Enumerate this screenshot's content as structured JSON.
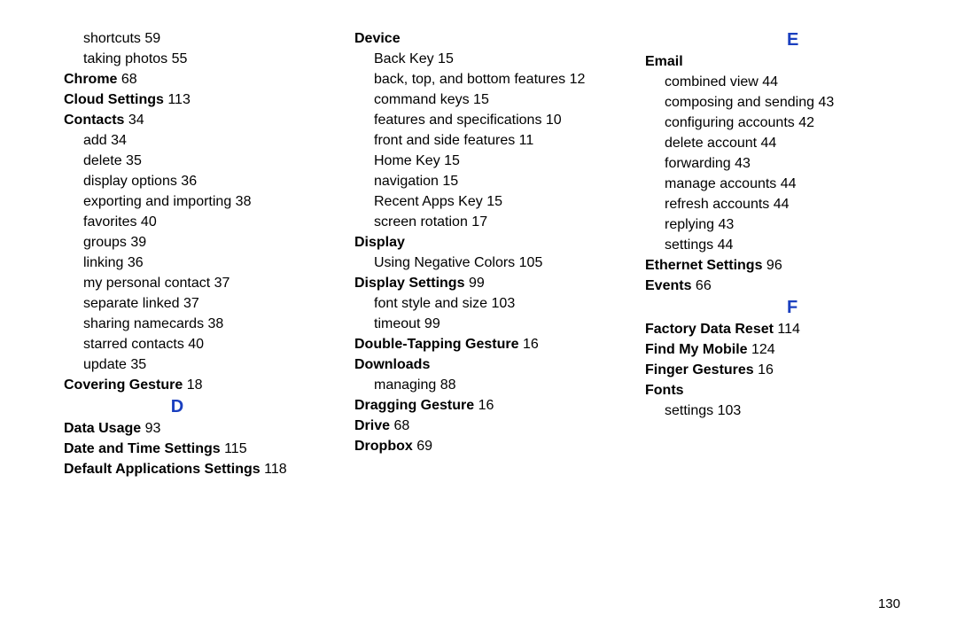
{
  "page_number": "130",
  "columns": [
    {
      "items": [
        {
          "type": "sub",
          "text": "shortcuts",
          "page": "59"
        },
        {
          "type": "sub",
          "text": "taking photos",
          "page": "55"
        },
        {
          "type": "head",
          "text": "Chrome",
          "page": "68"
        },
        {
          "type": "head",
          "text": "Cloud Settings",
          "page": "113"
        },
        {
          "type": "head",
          "text": "Contacts",
          "page": "34"
        },
        {
          "type": "sub",
          "text": "add",
          "page": "34"
        },
        {
          "type": "sub",
          "text": "delete",
          "page": "35"
        },
        {
          "type": "sub",
          "text": "display options",
          "page": "36"
        },
        {
          "type": "sub",
          "text": "exporting and importing",
          "page": "38"
        },
        {
          "type": "sub",
          "text": "favorites",
          "page": "40"
        },
        {
          "type": "sub",
          "text": "groups",
          "page": "39"
        },
        {
          "type": "sub",
          "text": "linking",
          "page": "36"
        },
        {
          "type": "sub",
          "text": "my personal contact",
          "page": "37"
        },
        {
          "type": "sub",
          "text": "separate linked",
          "page": "37"
        },
        {
          "type": "sub",
          "text": "sharing namecards",
          "page": "38"
        },
        {
          "type": "sub",
          "text": "starred contacts",
          "page": "40"
        },
        {
          "type": "sub",
          "text": "update",
          "page": "35"
        },
        {
          "type": "head",
          "text": "Covering Gesture",
          "page": "18"
        },
        {
          "type": "letter",
          "text": "D"
        },
        {
          "type": "head",
          "text": "Data Usage",
          "page": "93"
        },
        {
          "type": "head",
          "text": "Date and Time Settings",
          "page": "115"
        },
        {
          "type": "head",
          "text": "Default Applications Settings",
          "page": "118"
        }
      ]
    },
    {
      "items": [
        {
          "type": "head",
          "text": "Device",
          "page": ""
        },
        {
          "type": "sub",
          "text": "Back Key",
          "page": "15"
        },
        {
          "type": "sub",
          "text": "back, top, and bottom features",
          "page": "12"
        },
        {
          "type": "sub",
          "text": "command keys",
          "page": "15"
        },
        {
          "type": "sub",
          "text": "features and specifications",
          "page": "10"
        },
        {
          "type": "sub",
          "text": "front and side features",
          "page": "11"
        },
        {
          "type": "sub",
          "text": "Home Key",
          "page": "15"
        },
        {
          "type": "sub",
          "text": "navigation",
          "page": "15"
        },
        {
          "type": "sub",
          "text": "Recent Apps Key",
          "page": "15"
        },
        {
          "type": "sub",
          "text": "screen rotation",
          "page": "17"
        },
        {
          "type": "head",
          "text": "Display",
          "page": ""
        },
        {
          "type": "sub",
          "text": "Using Negative Colors",
          "page": "105"
        },
        {
          "type": "head",
          "text": "Display Settings",
          "page": "99"
        },
        {
          "type": "sub",
          "text": "font style and size",
          "page": "103"
        },
        {
          "type": "sub",
          "text": "timeout",
          "page": "99"
        },
        {
          "type": "head",
          "text": "Double-Tapping Gesture",
          "page": "16"
        },
        {
          "type": "head",
          "text": "Downloads",
          "page": ""
        },
        {
          "type": "sub",
          "text": "managing",
          "page": "88"
        },
        {
          "type": "head",
          "text": "Dragging Gesture",
          "page": "16"
        },
        {
          "type": "head",
          "text": "Drive",
          "page": "68"
        },
        {
          "type": "head",
          "text": "Dropbox",
          "page": "69"
        }
      ]
    },
    {
      "items": [
        {
          "type": "letter",
          "text": "E",
          "align": "right"
        },
        {
          "type": "head",
          "text": "Email",
          "page": ""
        },
        {
          "type": "sub",
          "text": "combined view",
          "page": "44"
        },
        {
          "type": "sub",
          "text": "composing and sending",
          "page": "43"
        },
        {
          "type": "sub",
          "text": "configuring accounts",
          "page": "42"
        },
        {
          "type": "sub",
          "text": "delete account",
          "page": "44"
        },
        {
          "type": "sub",
          "text": "forwarding",
          "page": "43"
        },
        {
          "type": "sub",
          "text": "manage accounts",
          "page": "44"
        },
        {
          "type": "sub",
          "text": "refresh accounts",
          "page": "44"
        },
        {
          "type": "sub",
          "text": "replying",
          "page": "43"
        },
        {
          "type": "sub",
          "text": "settings",
          "page": "44"
        },
        {
          "type": "head",
          "text": "Ethernet Settings",
          "page": "96"
        },
        {
          "type": "head",
          "text": "Events",
          "page": "66"
        },
        {
          "type": "letter",
          "text": "F",
          "align": "right"
        },
        {
          "type": "head",
          "text": "Factory Data Reset",
          "page": "114"
        },
        {
          "type": "head",
          "text": "Find My Mobile",
          "page": "124"
        },
        {
          "type": "head",
          "text": "Finger Gestures",
          "page": "16"
        },
        {
          "type": "head",
          "text": "Fonts",
          "page": ""
        },
        {
          "type": "sub",
          "text": "settings",
          "page": "103"
        }
      ]
    }
  ]
}
